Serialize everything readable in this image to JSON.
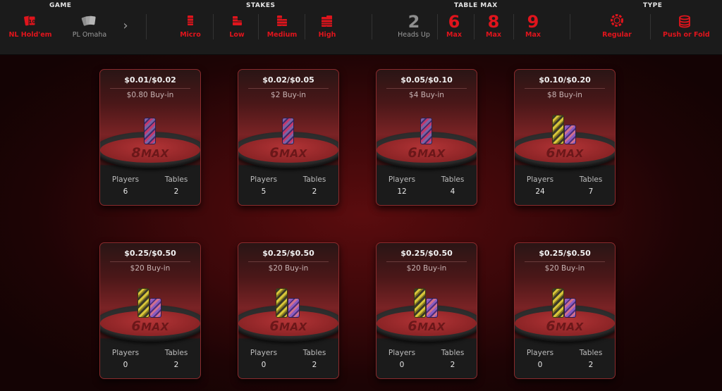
{
  "filters": {
    "game": {
      "title": "GAME",
      "options": [
        {
          "label": "NL Hold'em",
          "icon": "cards-red-icon",
          "active": true
        },
        {
          "label": "PL Omaha",
          "icon": "cards-gray-icon",
          "active": false
        }
      ],
      "more": "›"
    },
    "stakes": {
      "title": "STAKES",
      "options": [
        {
          "label": "Micro",
          "icon": "chip-stack-icon"
        },
        {
          "label": "Low",
          "icon": "chip-stack-icon"
        },
        {
          "label": "Medium",
          "icon": "chip-stack-icon"
        },
        {
          "label": "High",
          "icon": "chip-stack-icon"
        }
      ]
    },
    "table_max": {
      "title": "TABLE MAX",
      "options": [
        {
          "num": "2",
          "label": "Heads Up",
          "active": false
        },
        {
          "num": "6",
          "label": "Max",
          "active": true
        },
        {
          "num": "8",
          "label": "Max",
          "active": true
        },
        {
          "num": "9",
          "label": "Max",
          "active": true
        }
      ]
    },
    "type": {
      "title": "TYPE",
      "options": [
        {
          "label": "Regular",
          "icon": "poker-chip-icon"
        },
        {
          "label": "Push or Fold",
          "icon": "coin-stack-icon"
        }
      ]
    }
  },
  "accent_color": "#e0141c",
  "labels": {
    "players": "Players",
    "tables": "Tables"
  },
  "tables": [
    {
      "stakes": "$0.01/$0.02",
      "buyin": "$0.80 Buy-in",
      "max": "8",
      "players": "6",
      "tables": "2",
      "chips": "single"
    },
    {
      "stakes": "$0.02/$0.05",
      "buyin": "$2 Buy-in",
      "max": "6",
      "players": "5",
      "tables": "2",
      "chips": "single"
    },
    {
      "stakes": "$0.05/$0.10",
      "buyin": "$4 Buy-in",
      "max": "6",
      "players": "12",
      "tables": "4",
      "chips": "single"
    },
    {
      "stakes": "$0.10/$0.20",
      "buyin": "$8 Buy-in",
      "max": "6",
      "players": "24",
      "tables": "7",
      "chips": "double"
    },
    {
      "stakes": "$0.25/$0.50",
      "buyin": "$20 Buy-in",
      "max": "6",
      "players": "0",
      "tables": "2",
      "chips": "double"
    },
    {
      "stakes": "$0.25/$0.50",
      "buyin": "$20 Buy-in",
      "max": "6",
      "players": "0",
      "tables": "2",
      "chips": "double"
    },
    {
      "stakes": "$0.25/$0.50",
      "buyin": "$20 Buy-in",
      "max": "6",
      "players": "0",
      "tables": "2",
      "chips": "double"
    },
    {
      "stakes": "$0.25/$0.50",
      "buyin": "$20 Buy-in",
      "max": "6",
      "players": "0",
      "tables": "2",
      "chips": "double"
    }
  ],
  "max_word": "MAX"
}
